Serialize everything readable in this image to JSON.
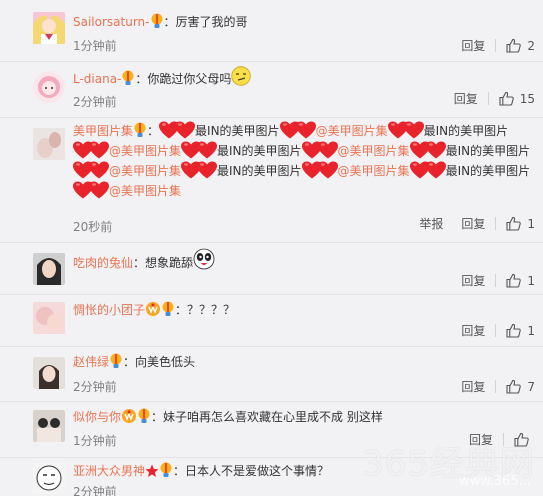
{
  "comments": [
    {
      "user": "Sailorsaturn-",
      "avatar": "sailor-moon-avatar",
      "badges": [
        "bulb"
      ],
      "segments": [
        {
          "t": "text",
          "v": "：厉害了我的哥"
        }
      ],
      "time": "1分钟前",
      "reply": "回复",
      "likes": "2",
      "report": ""
    },
    {
      "user": "L-diana-",
      "avatar": "pink-girl-avatar",
      "badges": [
        "bulb"
      ],
      "segments": [
        {
          "t": "text",
          "v": "：你跪过你父母吗"
        },
        {
          "t": "emoji",
          "v": "smirk-emoji"
        }
      ],
      "time": "2分钟前",
      "reply": "回复",
      "likes": "15",
      "report": ""
    },
    {
      "user": "美甲图片集",
      "avatar": "nail-photo-avatar",
      "badges": [
        "bulb"
      ],
      "segments": [
        {
          "t": "text",
          "v": "："
        },
        {
          "t": "hearts"
        },
        {
          "t": "text",
          "v": "最IN的美甲图片"
        },
        {
          "t": "hearts"
        },
        {
          "t": "mention",
          "v": "@美甲图片集"
        },
        {
          "t": "hearts"
        },
        {
          "t": "text",
          "v": "最IN的美甲图片"
        },
        {
          "t": "hearts"
        },
        {
          "t": "mention",
          "v": "@美甲图片集"
        },
        {
          "t": "hearts"
        },
        {
          "t": "text",
          "v": "最IN的美甲图片"
        },
        {
          "t": "hearts"
        },
        {
          "t": "mention",
          "v": "@美甲图片集"
        },
        {
          "t": "hearts"
        },
        {
          "t": "text",
          "v": "最IN的美甲图片"
        },
        {
          "t": "hearts"
        },
        {
          "t": "mention",
          "v": "@美甲图片集"
        },
        {
          "t": "hearts"
        },
        {
          "t": "text",
          "v": "最IN的美甲图片"
        },
        {
          "t": "hearts"
        },
        {
          "t": "mention",
          "v": "@美甲图片集"
        },
        {
          "t": "hearts"
        },
        {
          "t": "text",
          "v": "最IN的美甲图片"
        },
        {
          "t": "hearts"
        },
        {
          "t": "mention",
          "v": "@美甲图片集"
        }
      ],
      "time": "20秒前",
      "reply": "回复",
      "likes": "1",
      "report": "举报"
    },
    {
      "user": "吃肉的兔仙",
      "avatar": "dark-hair-girl-avatar",
      "badges": [],
      "segments": [
        {
          "t": "text",
          "v": "：想象跪舔"
        },
        {
          "t": "emoji",
          "v": "panda-face-emoji"
        }
      ],
      "time": "",
      "reply": "回复",
      "likes": "1",
      "report": ""
    },
    {
      "user": "惆怅的小团子",
      "avatar": "pink-blur-avatar",
      "badges": [
        "vip",
        "bulb"
      ],
      "segments": [
        {
          "t": "text",
          "v": "：？？？？"
        }
      ],
      "time": "",
      "reply": "回复",
      "likes": "1",
      "report": ""
    },
    {
      "user": "赵伟绿",
      "avatar": "girl-portrait-avatar",
      "badges": [
        "bulb"
      ],
      "segments": [
        {
          "t": "text",
          "v": "：向美色低头"
        }
      ],
      "time": "2分钟前",
      "reply": "回复",
      "likes": "7",
      "report": ""
    },
    {
      "user": "似你与你",
      "avatar": "group-photo-avatar",
      "badges": [
        "vip",
        "bulb"
      ],
      "segments": [
        {
          "t": "text",
          "v": "：妹子咱再怎么喜欢藏在心里成不成 别这样"
        }
      ],
      "time": "1分钟前",
      "reply": "回复",
      "likes": "",
      "report": ""
    },
    {
      "user": "亚洲大众男神",
      "avatar": "cartoon-face-avatar",
      "badges": [
        "star",
        "bulb"
      ],
      "segments": [
        {
          "t": "text",
          "v": "：日本人不是爱做这个事情？"
        }
      ],
      "time": "2分钟前",
      "reply": "",
      "likes": "",
      "report": ""
    }
  ],
  "watermark": {
    "main": "365经典网",
    "sub": "www.365..."
  },
  "colors": {
    "name": "#eb7350",
    "heart": "#e8232b",
    "bg": "#f2f2f5"
  }
}
